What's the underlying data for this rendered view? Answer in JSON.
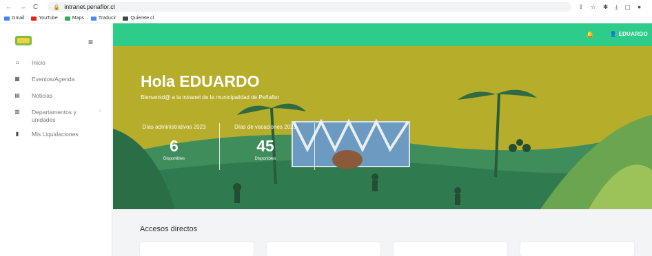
{
  "browser": {
    "url": "intranet.penaflor.cl",
    "bookmarks": [
      "Gmail",
      "YouTube",
      "Maps",
      "Traducir",
      "Quierete.cl"
    ]
  },
  "topbar": {
    "user": "EDUARDO"
  },
  "sidebar": {
    "items": [
      {
        "label": "Inicio",
        "icon": "home-icon"
      },
      {
        "label": "Eventos/Agenda",
        "icon": "calendar-icon"
      },
      {
        "label": "Noticias",
        "icon": "newspaper-icon"
      },
      {
        "label": "Departamentos y unidades",
        "icon": "building-icon"
      },
      {
        "label": "Mis Liquidaciones",
        "icon": "document-icon"
      }
    ]
  },
  "hero": {
    "greeting": "Hola EDUARDO",
    "welcome": "Bienvenid@ a la intranet de la municipalidad de Peñaflor",
    "stats": [
      {
        "label": "Días administrativos 2023",
        "value": "6",
        "sub": "Disponibles"
      },
      {
        "label": "Días de vacaciones 2023",
        "value": "45",
        "sub": "Disponibles"
      }
    ]
  },
  "main": {
    "section_title": "Accesos directos"
  },
  "colors": {
    "accent": "#2ecc8a",
    "hero_bg": "#b8b12a"
  }
}
